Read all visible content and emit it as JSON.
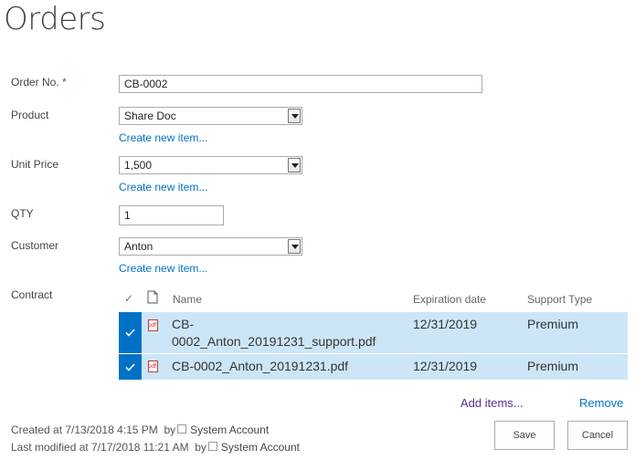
{
  "page": {
    "title": "Orders"
  },
  "form": {
    "order_no": {
      "label": "Order No.",
      "required_mark": "*",
      "value": "CB-0002"
    },
    "product": {
      "label": "Product",
      "value": "Share Doc",
      "create_link": "Create new item..."
    },
    "unit_price": {
      "label": "Unit Price",
      "value": "1,500",
      "create_link": "Create new item..."
    },
    "qty": {
      "label": "QTY",
      "value": "1"
    },
    "customer": {
      "label": "Customer",
      "value": "Anton",
      "create_link": "Create new item..."
    },
    "contract": {
      "label": "Contract",
      "columns": {
        "check": "✓",
        "name": "Name",
        "expiration": "Expiration date",
        "support": "Support Type"
      },
      "rows": [
        {
          "name_line1": "CB-",
          "name_line2": "0002_Anton_20191231_support.pdf",
          "expiration": "12/31/2019",
          "support": "Premium",
          "icon": "pdf-file-icon"
        },
        {
          "name_line1": "CB-0002_Anton_20191231.pdf",
          "expiration": "12/31/2019",
          "support": "Premium",
          "icon": "pdf-file-icon"
        }
      ],
      "add_items": "Add items...",
      "remove": "Remove"
    }
  },
  "footer": {
    "created_prefix": "Created at 7/13/2018 4:15 PM  by",
    "created_user": "System Account",
    "modified_prefix": "Last modified at 7/17/2018 11:21 AM  by",
    "modified_user": "System Account",
    "save": "Save",
    "cancel": "Cancel"
  },
  "colors": {
    "accent": "#0072c6",
    "selected_row": "#cde6f7",
    "link_purple": "#5c2d91"
  }
}
